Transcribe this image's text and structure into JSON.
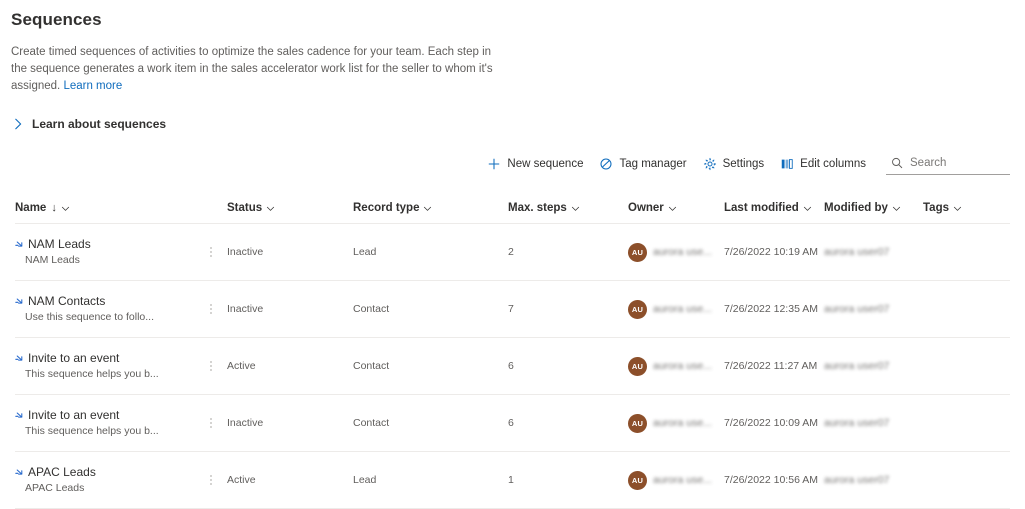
{
  "page": {
    "title": "Sequences",
    "description_part1": "Create timed sequences of activities to optimize the sales cadence for your team. Each step in the sequence generates a work item in the sales accelerator work list for the seller to whom it's assigned. ",
    "learn_more_label": "Learn more"
  },
  "expander": {
    "label": "Learn about sequences",
    "icon": "chevron-right-icon",
    "expanded": false
  },
  "commandbar": {
    "new_sequence": {
      "label": "New sequence",
      "icon": "plus-icon"
    },
    "tag_manager": {
      "label": "Tag manager",
      "icon": "tag-icon"
    },
    "settings": {
      "label": "Settings",
      "icon": "gear-icon"
    },
    "edit_columns": {
      "label": "Edit columns",
      "icon": "columns-icon"
    },
    "search": {
      "placeholder": "Search",
      "value": "",
      "icon": "search-icon"
    }
  },
  "grid": {
    "columns": [
      {
        "key": "name",
        "label": "Name",
        "sorted": "ascending",
        "sort_glyph": "↓"
      },
      {
        "key": "status",
        "label": "Status"
      },
      {
        "key": "record_type",
        "label": "Record type"
      },
      {
        "key": "max_steps",
        "label": "Max. steps"
      },
      {
        "key": "owner",
        "label": "Owner"
      },
      {
        "key": "last_modified",
        "label": "Last modified"
      },
      {
        "key": "modified_by",
        "label": "Modified by"
      },
      {
        "key": "tags",
        "label": "Tags"
      }
    ],
    "rows": [
      {
        "name": "NAM Leads",
        "description": "NAM Leads",
        "status": "Inactive",
        "record_type": "Lead",
        "max_steps": "2",
        "owner_initials": "AU",
        "owner": "aurora use...",
        "last_modified": "7/26/2022 10:19 AM",
        "modified_by": "aurora user07",
        "tags": ""
      },
      {
        "name": "NAM Contacts",
        "description": "Use this sequence to follo...",
        "status": "Inactive",
        "record_type": "Contact",
        "max_steps": "7",
        "owner_initials": "AU",
        "owner": "aurora use...",
        "last_modified": "7/26/2022 12:35 AM",
        "modified_by": "aurora user07",
        "tags": ""
      },
      {
        "name": "Invite to an event",
        "description": "This sequence helps you b...",
        "status": "Active",
        "record_type": "Contact",
        "max_steps": "6",
        "owner_initials": "AU",
        "owner": "aurora use...",
        "last_modified": "7/26/2022 11:27 AM",
        "modified_by": "aurora user07",
        "tags": ""
      },
      {
        "name": "Invite to an event",
        "description": "This sequence helps you b...",
        "status": "Inactive",
        "record_type": "Contact",
        "max_steps": "6",
        "owner_initials": "AU",
        "owner": "aurora use...",
        "last_modified": "7/26/2022 10:09 AM",
        "modified_by": "aurora user07",
        "tags": ""
      },
      {
        "name": "APAC Leads",
        "description": "APAC Leads",
        "status": "Active",
        "record_type": "Lead",
        "max_steps": "1",
        "owner_initials": "AU",
        "owner": "aurora use...",
        "last_modified": "7/26/2022 10:56 AM",
        "modified_by": "aurora user07",
        "tags": ""
      }
    ],
    "row_icon": "sequence-icon",
    "row_menu_icon": "more-vertical-icon"
  },
  "colors": {
    "accent": "#0f6cbd",
    "avatar": "#8c4f2a",
    "text_primary": "#323130",
    "text_secondary": "#605e5c",
    "divider": "#edebe9"
  }
}
